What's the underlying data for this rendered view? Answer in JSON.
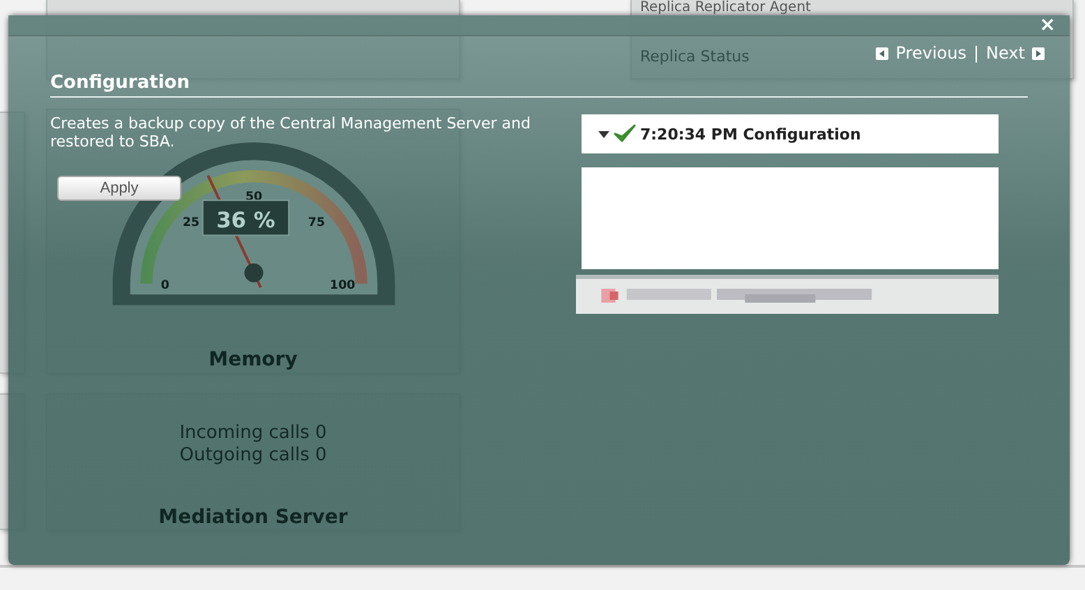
{
  "background": {
    "agent_card": {
      "lines": [
        "Replica Replicator Agent",
        "Replica Status"
      ]
    },
    "memory_card": {
      "title": "Memory",
      "gauge": {
        "level": 0.36,
        "reading": "36 %",
        "ticks": [
          "0",
          "25",
          "50",
          "75",
          "100"
        ]
      }
    },
    "mediation_card": {
      "title": "Mediation Server",
      "lines": [
        "Incoming calls 0",
        "Outgoing calls 0"
      ]
    }
  },
  "dialog": {
    "close": "×",
    "nav": {
      "previous": "Previous",
      "separator": "|",
      "next": "Next"
    },
    "title": "Configuration",
    "description": "Creates a backup copy of the Central Management Server and restored to SBA.",
    "apply_button": "Apply",
    "log": {
      "entry": "7:20:34 PM Configuration",
      "succeeded": true,
      "expanded": true
    }
  }
}
